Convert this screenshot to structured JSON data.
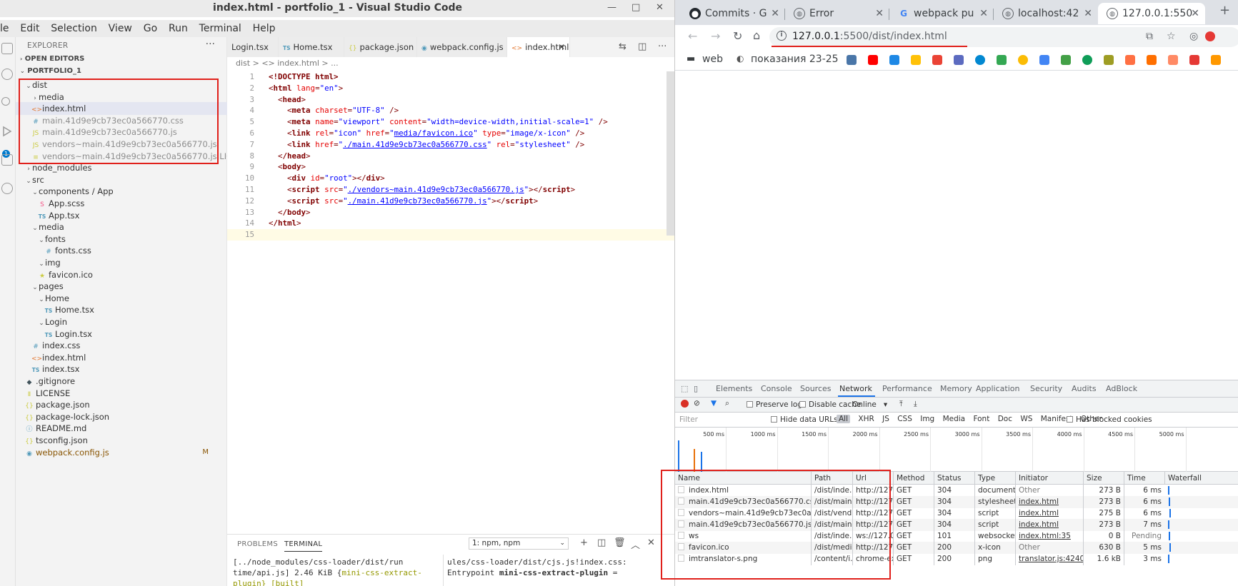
{
  "vscode": {
    "title": "index.html - portfolio_1 - Visual Studio Code",
    "menu": [
      "le",
      "Edit",
      "Selection",
      "View",
      "Go",
      "Run",
      "Terminal",
      "Help"
    ],
    "activity_badge": "1",
    "explorer": {
      "header": "EXPLORER",
      "open_editors": "OPEN EDITORS",
      "project": "PORTFOLIO_1",
      "tree": [
        {
          "label": "dist",
          "depth": 1,
          "chev": "v",
          "icon": "",
          "kind": "folder"
        },
        {
          "label": "media",
          "depth": 2,
          "chev": ">",
          "icon": "",
          "kind": "folder"
        },
        {
          "label": "index.html",
          "depth": 2,
          "chev": "",
          "icon": "<>",
          "kind": "html",
          "selected": true
        },
        {
          "label": "main.41d9e9cb73ec0a566770.css",
          "depth": 2,
          "chev": "",
          "icon": "#",
          "kind": "css",
          "ignored": true
        },
        {
          "label": "main.41d9e9cb73ec0a566770.js",
          "depth": 2,
          "chev": "",
          "icon": "JS",
          "kind": "js",
          "ignored": true
        },
        {
          "label": "vendors~main.41d9e9cb73ec0a566770.js",
          "depth": 2,
          "chev": "",
          "icon": "JS",
          "kind": "js",
          "ignored": true
        },
        {
          "label": "vendors~main.41d9e9cb73ec0a566770.js.LICENSE.txt",
          "depth": 2,
          "chev": "",
          "icon": "≡",
          "kind": "txt",
          "ignored": true
        },
        {
          "label": "node_modules",
          "depth": 1,
          "chev": ">",
          "icon": "",
          "kind": "folder"
        },
        {
          "label": "src",
          "depth": 1,
          "chev": "v",
          "icon": "",
          "kind": "folder"
        },
        {
          "label": "components / App",
          "depth": 2,
          "chev": "v",
          "icon": "",
          "kind": "folder"
        },
        {
          "label": "App.scss",
          "depth": 3,
          "chev": "",
          "icon": "S",
          "kind": "scss"
        },
        {
          "label": "App.tsx",
          "depth": 3,
          "chev": "",
          "icon": "TS",
          "kind": "ts"
        },
        {
          "label": "media",
          "depth": 2,
          "chev": "v",
          "icon": "",
          "kind": "folder"
        },
        {
          "label": "fonts",
          "depth": 3,
          "chev": "v",
          "icon": "",
          "kind": "folder"
        },
        {
          "label": "fonts.css",
          "depth": 4,
          "chev": "",
          "icon": "#",
          "kind": "css"
        },
        {
          "label": "img",
          "depth": 3,
          "chev": "v",
          "icon": "",
          "kind": "folder"
        },
        {
          "label": "favicon.ico",
          "depth": 3,
          "chev": "",
          "icon": "★",
          "kind": "fav"
        },
        {
          "label": "pages",
          "depth": 2,
          "chev": "v",
          "icon": "",
          "kind": "folder"
        },
        {
          "label": "Home",
          "depth": 3,
          "chev": "v",
          "icon": "",
          "kind": "folder"
        },
        {
          "label": "Home.tsx",
          "depth": 4,
          "chev": "",
          "icon": "TS",
          "kind": "ts"
        },
        {
          "label": "Login",
          "depth": 3,
          "chev": "v",
          "icon": "",
          "kind": "folder"
        },
        {
          "label": "Login.tsx",
          "depth": 4,
          "chev": "",
          "icon": "TS",
          "kind": "ts"
        },
        {
          "label": "index.css",
          "depth": 2,
          "chev": "",
          "icon": "#",
          "kind": "css"
        },
        {
          "label": "index.html",
          "depth": 2,
          "chev": "",
          "icon": "<>",
          "kind": "html"
        },
        {
          "label": "index.tsx",
          "depth": 2,
          "chev": "",
          "icon": "TS",
          "kind": "ts"
        },
        {
          "label": ".gitignore",
          "depth": 1,
          "chev": "",
          "icon": "◆",
          "kind": "git"
        },
        {
          "label": "LICENSE",
          "depth": 1,
          "chev": "",
          "icon": "Ⅱ",
          "kind": "lic"
        },
        {
          "label": "package.json",
          "depth": 1,
          "chev": "",
          "icon": "{}",
          "kind": "json"
        },
        {
          "label": "package-lock.json",
          "depth": 1,
          "chev": "",
          "icon": "{}",
          "kind": "json"
        },
        {
          "label": "README.md",
          "depth": 1,
          "chev": "",
          "icon": "ⓘ",
          "kind": "info"
        },
        {
          "label": "tsconfig.json",
          "depth": 1,
          "chev": "",
          "icon": "{}",
          "kind": "json"
        },
        {
          "label": "webpack.config.js",
          "depth": 1,
          "chev": "",
          "icon": "◉",
          "kind": "webpack",
          "modified": "M"
        }
      ]
    },
    "tabs": [
      {
        "label": "Login.tsx",
        "icon": ""
      },
      {
        "label": "Home.tsx",
        "icon": "TS"
      },
      {
        "label": "package.json",
        "icon": "{}"
      },
      {
        "label": "webpack.config.js",
        "icon": "◉"
      },
      {
        "label": "index.html",
        "icon": "<>",
        "active": true
      }
    ],
    "breadcrumb": [
      "dist",
      ">",
      "<> index.html",
      ">",
      "..."
    ],
    "code_lines": [
      "1",
      "2",
      "3",
      "4",
      "5",
      "6",
      "7",
      "8",
      "9",
      "10",
      "11",
      "12",
      "13",
      "14",
      "15"
    ],
    "code": {
      "l1": "<!DOCTYPE html>",
      "l2_tag": "html",
      "l2_attr": "lang",
      "l2_val": "\"en\"",
      "l3": "head",
      "l4_attr": "charset",
      "l4_val": "\"UTF-8\"",
      "l5_attr1": "name",
      "l5_val1": "\"viewport\"",
      "l5_attr2": "content",
      "l5_val2": "\"width=device-width,initial-scale=1\"",
      "l6_attr1": "rel",
      "l6_val1": "\"icon\"",
      "l6_attr2": "href",
      "l6_url": "media/favicon.ico",
      "l6_attr3": "type",
      "l6_val3": "\"image/x-icon\"",
      "l7_attr1": "href",
      "l7_url": "./main.41d9e9cb73ec0a566770.css",
      "l7_attr2": "rel",
      "l7_val2": "\"stylesheet\"",
      "l8": "/head",
      "l9": "body",
      "l10_attr": "id",
      "l10_val": "\"root\"",
      "l11_url": "./vendors~main.41d9e9cb73ec0a566770.js",
      "l12_url": "./main.41d9e9cb73ec0a566770.js",
      "l13": "/body",
      "l14": "/html"
    },
    "panel": {
      "tabs": [
        "PROBLEMS",
        "TERMINAL"
      ],
      "terminal_select": "1: npm, npm",
      "left_l1": "[../node_modules/css-loader/dist/run",
      "left_l2a": "time/api.js] 2.46 KiB {",
      "left_l2b": "mini-css-extract-",
      "left_l3": "plugin} [built]",
      "right_l1": "ules/css-loader/dist/cjs.js!index.css:",
      "right_l2a": "Entrypoint ",
      "right_l2b": "mini-css-extract-plugin",
      "right_l2c": " ="
    }
  },
  "chrome": {
    "tabs": [
      {
        "label": "Commits · G",
        "icon": "github-icon"
      },
      {
        "label": "Error",
        "icon": "globe-icon"
      },
      {
        "label": "webpack pu",
        "icon": "google-icon"
      },
      {
        "label": "localhost:42",
        "icon": "globe-icon"
      },
      {
        "label": "127.0.0.1:550",
        "icon": "globe-icon",
        "active": true
      }
    ],
    "url_host": "127.0.0.1",
    "url_rest": ":5500/dist/index.html",
    "bookmarks": [
      "web",
      "показания 23-25"
    ],
    "devtools": {
      "tabs": [
        "Elements",
        "Console",
        "Sources",
        "Network",
        "Performance",
        "Memory",
        "Application",
        "Security",
        "Audits",
        "AdBlock"
      ],
      "active_tab": "Network",
      "preserve_log": "Preserve log",
      "disable_cache": "Disable cache",
      "throttle": "Online",
      "filter_placeholder": "Filter",
      "hide_data_urls": "Hide data URLs",
      "types": [
        "All",
        "XHR",
        "JS",
        "CSS",
        "Img",
        "Media",
        "Font",
        "Doc",
        "WS",
        "Manifest",
        "Other"
      ],
      "has_blocked_cookies": "Has blocked cookies",
      "timeline_ticks": [
        "500 ms",
        "1000 ms",
        "1500 ms",
        "2000 ms",
        "2500 ms",
        "3000 ms",
        "3500 ms",
        "4000 ms",
        "4500 ms",
        "5000 ms"
      ],
      "columns": [
        "Name",
        "Path",
        "Url",
        "Method",
        "Status",
        "Type",
        "Initiator",
        "Size",
        "Time",
        "Waterfall"
      ],
      "rows": [
        {
          "name": "index.html",
          "path": "/dist/inde...",
          "url": "http://127...",
          "method": "GET",
          "status": "304",
          "type": "document",
          "initiator": "Other",
          "size": "273 B",
          "time": "6 ms"
        },
        {
          "name": "main.41d9e9cb73ec0a566770.css",
          "path": "/dist/main...",
          "url": "http://127...",
          "method": "GET",
          "status": "304",
          "type": "stylesheet",
          "initiator": "index.html",
          "size": "273 B",
          "time": "6 ms"
        },
        {
          "name": "vendors~main.41d9e9cb73ec0a566770.js",
          "path": "/dist/vend...",
          "url": "http://127...",
          "method": "GET",
          "status": "304",
          "type": "script",
          "initiator": "index.html",
          "size": "275 B",
          "time": "6 ms"
        },
        {
          "name": "main.41d9e9cb73ec0a566770.js",
          "path": "/dist/main...",
          "url": "http://127...",
          "method": "GET",
          "status": "304",
          "type": "script",
          "initiator": "index.html",
          "size": "273 B",
          "time": "7 ms"
        },
        {
          "name": "ws",
          "path": "/dist/inde...",
          "url": "ws://127.0...",
          "method": "GET",
          "status": "101",
          "type": "websocket",
          "initiator": "index.html:35",
          "size": "0 B",
          "time": "Pending"
        },
        {
          "name": "favicon.ico",
          "path": "/dist/medi...",
          "url": "http://127...",
          "method": "GET",
          "status": "200",
          "type": "x-icon",
          "initiator": "Other",
          "size": "630 B",
          "time": "5 ms"
        },
        {
          "name": "imtranslator-s.png",
          "path": "/content/i...",
          "url": "chrome-ex...",
          "method": "GET",
          "status": "200",
          "type": "png",
          "initiator": "translator.js:4240",
          "size": "1.6 kB",
          "time": "3 ms"
        }
      ]
    }
  }
}
